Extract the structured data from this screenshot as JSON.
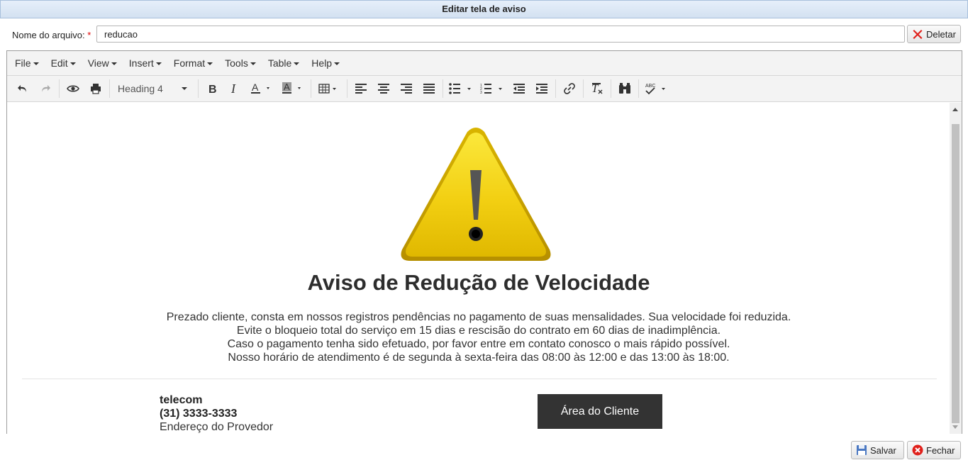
{
  "window": {
    "title": "Editar tela de aviso"
  },
  "file": {
    "label": "Nome do arquivo:",
    "required_mark": "*",
    "value": "reducao",
    "delete_label": "Deletar"
  },
  "menubar": [
    "File",
    "Edit",
    "View",
    "Insert",
    "Format",
    "Tools",
    "Table",
    "Help"
  ],
  "toolbar": {
    "format_value": "Heading 4",
    "icons": [
      "undo-icon",
      "redo-icon",
      "preview-icon",
      "print-icon",
      "bold-icon",
      "italic-icon",
      "text-color-icon",
      "background-color-icon",
      "table-icon",
      "align-left-icon",
      "align-center-icon",
      "align-right-icon",
      "justify-icon",
      "bullet-list-icon",
      "numbered-list-icon",
      "outdent-icon",
      "indent-icon",
      "link-icon",
      "clear-formatting-icon",
      "find-replace-icon",
      "spellcheck-icon"
    ]
  },
  "content": {
    "heading": "Aviso de Redução de Velocidade",
    "paragraph": [
      "Prezado cliente, consta em nossos registros pendências no pagamento de suas mensalidades. Sua velocidade foi reduzida.",
      "Evite o bloqueio total do serviço em 15 dias e rescisão do contrato em 60 dias de inadimplência.",
      "Caso o pagamento tenha sido efetuado, por favor entre em contato conosco o mais rápido possível.",
      "Nosso horário de atendimento é de segunda à sexta-feira das 08:00 às 12:00 e das 13:00 às 18:00."
    ],
    "company": "telecom",
    "phone": "(31) 3333-3333",
    "address": "Endereço do Provedor",
    "client_button": "Área do Cliente"
  },
  "footer": {
    "save_label": "Salvar",
    "close_label": "Fechar"
  },
  "colors": {
    "accent": "#d3e1f1",
    "warning_yellow": "#f2d21a",
    "button_dark": "#333333",
    "delete_red": "#e0201b"
  }
}
